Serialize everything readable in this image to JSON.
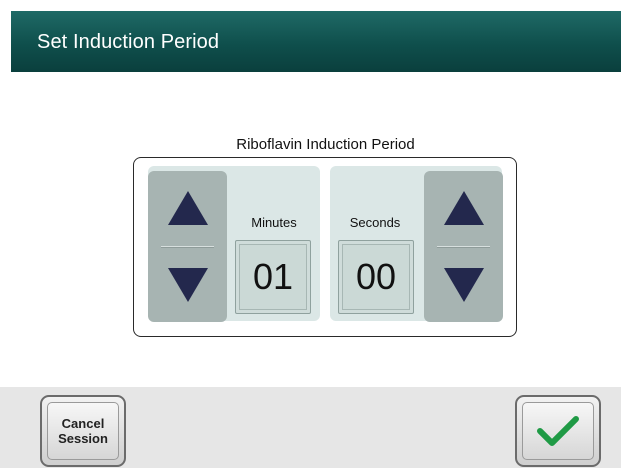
{
  "header": {
    "title": "Set Induction Period"
  },
  "panel": {
    "title": "Riboflavin Induction Period",
    "minutes": {
      "label": "Minutes",
      "value": "01",
      "up_icon": "arrow-up-icon",
      "down_icon": "arrow-down-icon"
    },
    "seconds": {
      "label": "Seconds",
      "value": "00",
      "up_icon": "arrow-up-icon",
      "down_icon": "arrow-down-icon"
    }
  },
  "footer": {
    "cancel_line1": "Cancel",
    "cancel_line2": "Session",
    "confirm_icon": "checkmark-icon"
  },
  "colors": {
    "header": "#0f4f4c",
    "arrow": "#23284d",
    "checkmark": "#1f9a45"
  }
}
